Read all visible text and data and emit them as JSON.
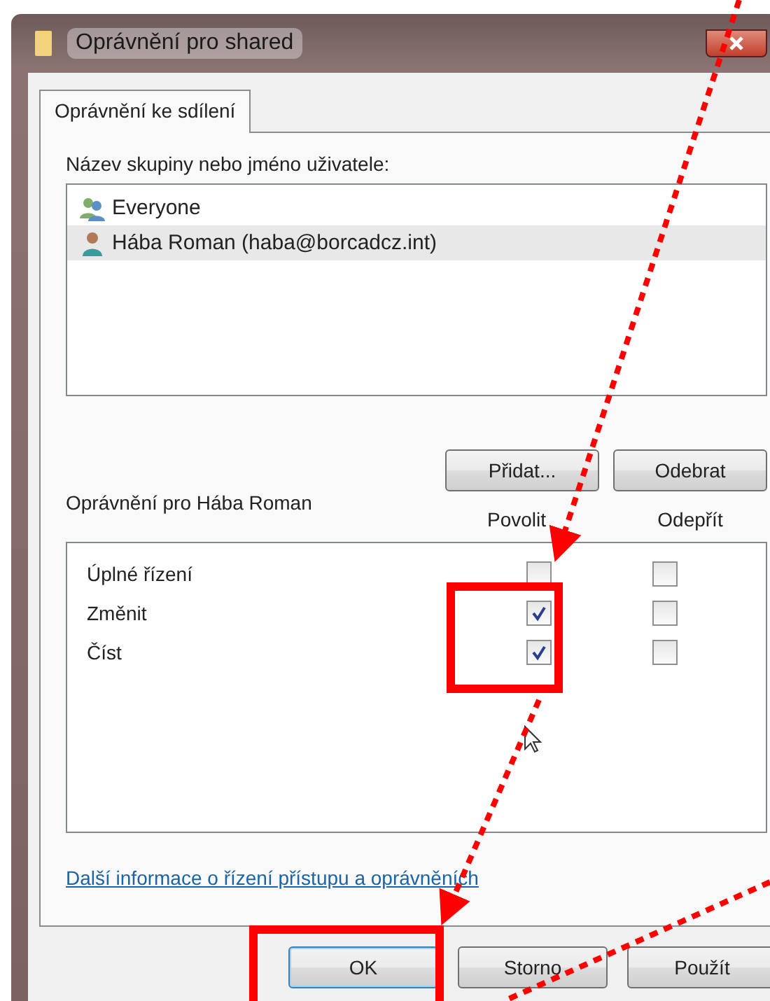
{
  "window": {
    "title": "Oprávnění pro shared"
  },
  "tabs": [
    {
      "label": "Oprávnění ke sdílení",
      "selected": true
    }
  ],
  "users": {
    "label": "Název skupiny nebo jméno uživatele:",
    "items": [
      {
        "name": "Everyone",
        "kind": "group",
        "selected": false
      },
      {
        "name": "Hába Roman (haba@borcadcz.int)",
        "kind": "user",
        "selected": true
      }
    ]
  },
  "user_buttons": [
    "Přidat...",
    "Odebrat"
  ],
  "permissions": {
    "label": "Oprávnění pro Hába Roman",
    "columns": [
      "Povolit",
      "Odepřít"
    ],
    "rows": [
      {
        "name": "Úplné řízení",
        "allow": false,
        "deny": false
      },
      {
        "name": "Změnit",
        "allow": true,
        "deny": false
      },
      {
        "name": "Číst",
        "allow": true,
        "deny": false
      }
    ]
  },
  "link": "Další informace o řízení přístupu a oprávněních",
  "dialog_buttons": [
    {
      "label": "OK",
      "default": true
    },
    {
      "label": "Storno",
      "default": false
    },
    {
      "label": "Použít",
      "default": false
    }
  ]
}
